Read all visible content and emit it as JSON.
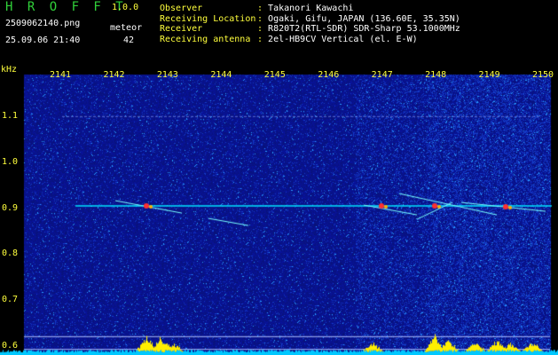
{
  "header": {
    "app_title": "H R O F F T",
    "version": "1.0.0",
    "filename": "2509062140.png",
    "capture_type": "meteor",
    "datetime": "25.09.06 21:40",
    "count": "42"
  },
  "info": [
    {
      "key": "Observer",
      "value": "Takanori Kawachi"
    },
    {
      "key": "Receiving Location",
      "value": "Ogaki, Gifu, JAPAN (136.60E, 35.35N)"
    },
    {
      "key": "Receiver",
      "value": "R820T2(RTL-SDR) SDR-Sharp 53.1000MHz"
    },
    {
      "key": "Receiving antenna",
      "value": "2el-HB9CV Vertical (el. E-W)"
    }
  ],
  "chart_data": {
    "type": "heatmap",
    "ylabel": "kHz",
    "x_ticks": [
      "2141",
      "2142",
      "2143",
      "2144",
      "2145",
      "2146",
      "2147",
      "2148",
      "2149",
      "2150"
    ],
    "y_ticks": [
      "1.1",
      "1.0",
      "0.9",
      "0.8",
      "0.7",
      "0.6"
    ],
    "ylim": [
      0.58,
      1.18
    ],
    "carrier_khz": 0.905,
    "reference_line_khz": 1.1,
    "colors": {
      "background": "#0a1a8c",
      "signal": "#00e5ff",
      "peak": "#ff3030",
      "level": "#ffee00",
      "base": "#00c8ff"
    }
  }
}
